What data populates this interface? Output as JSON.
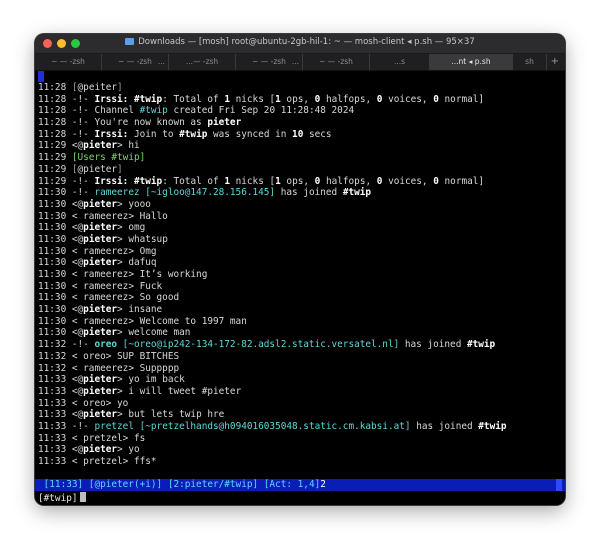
{
  "window": {
    "title": "Downloads — [mosh] root@ubuntu-2gb-hil-1: ~ — mosh-client ◂ p.sh — 95×37"
  },
  "tabs": [
    {
      "label": "~ — -zsh",
      "active": false
    },
    {
      "label": "~ — -zsh",
      "active": false
    },
    {
      "label": "...— -zsh",
      "active": false
    },
    {
      "label": "~ — -zsh",
      "active": false
    },
    {
      "label": "~ — -zsh",
      "active": false
    },
    {
      "label": "...s",
      "active": false
    },
    {
      "label": "...nt ◂ p.sh",
      "active": true
    },
    {
      "label": "sh",
      "active": false
    }
  ],
  "more_glyph": "...",
  "new_tab_glyph": "+",
  "log": [
    {
      "ts": "11:28",
      "parts": [
        {
          "t": "[",
          "c": "dim"
        },
        {
          "t": "@peiter",
          "c": ""
        },
        {
          "t": "]",
          "c": "dim"
        }
      ]
    },
    {
      "ts": "11:28",
      "parts": [
        {
          "t": "-!- ",
          "c": ""
        },
        {
          "t": "Irssi:",
          "c": "b"
        },
        {
          "t": " ",
          "c": ""
        },
        {
          "t": "#twip",
          "c": "b"
        },
        {
          "t": ": Total of ",
          "c": ""
        },
        {
          "t": "1",
          "c": "b"
        },
        {
          "t": " nicks [",
          "c": ""
        },
        {
          "t": "1",
          "c": "b"
        },
        {
          "t": " ops, ",
          "c": ""
        },
        {
          "t": "0",
          "c": "b"
        },
        {
          "t": " halfops, ",
          "c": ""
        },
        {
          "t": "0",
          "c": "b"
        },
        {
          "t": " voices, ",
          "c": ""
        },
        {
          "t": "0",
          "c": "b"
        },
        {
          "t": " normal]",
          "c": ""
        }
      ]
    },
    {
      "ts": "11:28",
      "parts": [
        {
          "t": "-!- Channel ",
          "c": ""
        },
        {
          "t": "#twip",
          "c": "cy"
        },
        {
          "t": " created Fri Sep 20 11:28:48 2024",
          "c": ""
        }
      ]
    },
    {
      "ts": "11:28",
      "parts": [
        {
          "t": "-!- You're now known as ",
          "c": ""
        },
        {
          "t": "pieter",
          "c": "b"
        }
      ]
    },
    {
      "ts": "11:28",
      "parts": [
        {
          "t": "-!- ",
          "c": ""
        },
        {
          "t": "Irssi:",
          "c": "b"
        },
        {
          "t": " Join to ",
          "c": ""
        },
        {
          "t": "#twip",
          "c": "b"
        },
        {
          "t": " was synced in ",
          "c": ""
        },
        {
          "t": "10",
          "c": "b"
        },
        {
          "t": " secs",
          "c": ""
        }
      ]
    },
    {
      "ts": "11:29",
      "parts": [
        {
          "t": "<@",
          "c": ""
        },
        {
          "t": "pieter",
          "c": "b"
        },
        {
          "t": "> hi",
          "c": ""
        }
      ]
    },
    {
      "ts": "11:29",
      "parts": [
        {
          "t": "[Users #twip]",
          "c": "gr"
        }
      ]
    },
    {
      "ts": "11:29",
      "parts": [
        {
          "t": "[",
          "c": "dim"
        },
        {
          "t": "@pieter",
          "c": ""
        },
        {
          "t": "]",
          "c": "dim"
        }
      ]
    },
    {
      "ts": "11:29",
      "parts": [
        {
          "t": "-!- ",
          "c": ""
        },
        {
          "t": "Irssi:",
          "c": "b"
        },
        {
          "t": " ",
          "c": ""
        },
        {
          "t": "#twip",
          "c": "b"
        },
        {
          "t": ": Total of ",
          "c": ""
        },
        {
          "t": "1",
          "c": "b"
        },
        {
          "t": " nicks [",
          "c": ""
        },
        {
          "t": "1",
          "c": "b"
        },
        {
          "t": " ops, ",
          "c": ""
        },
        {
          "t": "0",
          "c": "b"
        },
        {
          "t": " halfops, ",
          "c": ""
        },
        {
          "t": "0",
          "c": "b"
        },
        {
          "t": " voices, ",
          "c": ""
        },
        {
          "t": "0",
          "c": "b"
        },
        {
          "t": " normal]",
          "c": ""
        }
      ]
    },
    {
      "ts": "11:30",
      "parts": [
        {
          "t": "-!- ",
          "c": ""
        },
        {
          "t": "rameerez",
          "c": "cy"
        },
        {
          "t": " [~igloo@147.28.156.145]",
          "c": "cy"
        },
        {
          "t": " has joined ",
          "c": ""
        },
        {
          "t": "#twip",
          "c": "b"
        }
      ]
    },
    {
      "ts": "11:30",
      "parts": [
        {
          "t": "<@",
          "c": ""
        },
        {
          "t": "pieter",
          "c": "b"
        },
        {
          "t": "> yooo",
          "c": ""
        }
      ]
    },
    {
      "ts": "11:30",
      "parts": [
        {
          "t": "< rameerez> Hallo",
          "c": ""
        }
      ]
    },
    {
      "ts": "11:30",
      "parts": [
        {
          "t": "<@",
          "c": ""
        },
        {
          "t": "pieter",
          "c": "b"
        },
        {
          "t": "> omg",
          "c": ""
        }
      ]
    },
    {
      "ts": "11:30",
      "parts": [
        {
          "t": "<@",
          "c": ""
        },
        {
          "t": "pieter",
          "c": "b"
        },
        {
          "t": "> whatsup",
          "c": ""
        }
      ]
    },
    {
      "ts": "11:30",
      "parts": [
        {
          "t": "< rameerez> Omg",
          "c": ""
        }
      ]
    },
    {
      "ts": "11:30",
      "parts": [
        {
          "t": "<@",
          "c": ""
        },
        {
          "t": "pieter",
          "c": "b"
        },
        {
          "t": "> dafuq",
          "c": ""
        }
      ]
    },
    {
      "ts": "11:30",
      "parts": [
        {
          "t": "< rameerez> It’s working",
          "c": ""
        }
      ]
    },
    {
      "ts": "11:30",
      "parts": [
        {
          "t": "< rameerez> Fuck",
          "c": ""
        }
      ]
    },
    {
      "ts": "11:30",
      "parts": [
        {
          "t": "< rameerez> So good",
          "c": ""
        }
      ]
    },
    {
      "ts": "11:30",
      "parts": [
        {
          "t": "<@",
          "c": ""
        },
        {
          "t": "pieter",
          "c": "b"
        },
        {
          "t": "> insane",
          "c": ""
        }
      ]
    },
    {
      "ts": "11:30",
      "parts": [
        {
          "t": "< rameerez> Welcome to 1997 man",
          "c": ""
        }
      ]
    },
    {
      "ts": "11:30",
      "parts": [
        {
          "t": "<@",
          "c": ""
        },
        {
          "t": "pieter",
          "c": "b"
        },
        {
          "t": "> welcome man",
          "c": ""
        }
      ]
    },
    {
      "ts": "11:32",
      "parts": [
        {
          "t": "-!- ",
          "c": ""
        },
        {
          "t": "oreo",
          "c": "cyb"
        },
        {
          "t": " [~oreo@ip242-134-172-82.adsl2.static.versatel.nl]",
          "c": "cy"
        },
        {
          "t": " has joined ",
          "c": ""
        },
        {
          "t": "#twip",
          "c": "b"
        }
      ]
    },
    {
      "ts": "11:32",
      "parts": [
        {
          "t": "< oreo> SUP BITCHES",
          "c": ""
        }
      ]
    },
    {
      "ts": "11:32",
      "parts": [
        {
          "t": "< rameerez> Suppppp",
          "c": ""
        }
      ]
    },
    {
      "ts": "11:33",
      "parts": [
        {
          "t": "<@",
          "c": ""
        },
        {
          "t": "pieter",
          "c": "b"
        },
        {
          "t": "> yo im back",
          "c": ""
        }
      ]
    },
    {
      "ts": "11:33",
      "parts": [
        {
          "t": "<@",
          "c": ""
        },
        {
          "t": "pieter",
          "c": "b"
        },
        {
          "t": "> i will tweet #pieter",
          "c": ""
        }
      ]
    },
    {
      "ts": "11:33",
      "parts": [
        {
          "t": "< oreo> yo",
          "c": ""
        }
      ]
    },
    {
      "ts": "11:33",
      "parts": [
        {
          "t": "<@",
          "c": ""
        },
        {
          "t": "pieter",
          "c": "b"
        },
        {
          "t": "> but lets twip hre",
          "c": ""
        }
      ]
    },
    {
      "ts": "11:33",
      "parts": [
        {
          "t": "-!- ",
          "c": ""
        },
        {
          "t": "pretzel",
          "c": "cy"
        },
        {
          "t": " [~pretzelhands@h094016035048.static.cm.kabsi.at]",
          "c": "cy"
        },
        {
          "t": " has joined ",
          "c": ""
        },
        {
          "t": "#twip",
          "c": "b"
        }
      ]
    },
    {
      "ts": "11:33",
      "parts": [
        {
          "t": "< pretzel> fs",
          "c": ""
        }
      ]
    },
    {
      "ts": "11:33",
      "parts": [
        {
          "t": "<@",
          "c": ""
        },
        {
          "t": "pieter",
          "c": "b"
        },
        {
          "t": "> yo",
          "c": ""
        }
      ]
    },
    {
      "ts": "11:33",
      "parts": [
        {
          "t": "< pretzel> ffs*",
          "c": ""
        }
      ]
    }
  ],
  "statusbar": {
    "time": " [11:33]",
    "nick": " [@pieter(+i)]",
    "window": " [2:pieter/#twip]",
    "act": " [Act: 1,4]",
    "act_tail": "2"
  },
  "input": {
    "prompt": "[#twip]"
  },
  "colors": {
    "status_bg": "#0b1db8",
    "cyan": "#5fd7d7",
    "green": "#7fd46a"
  }
}
